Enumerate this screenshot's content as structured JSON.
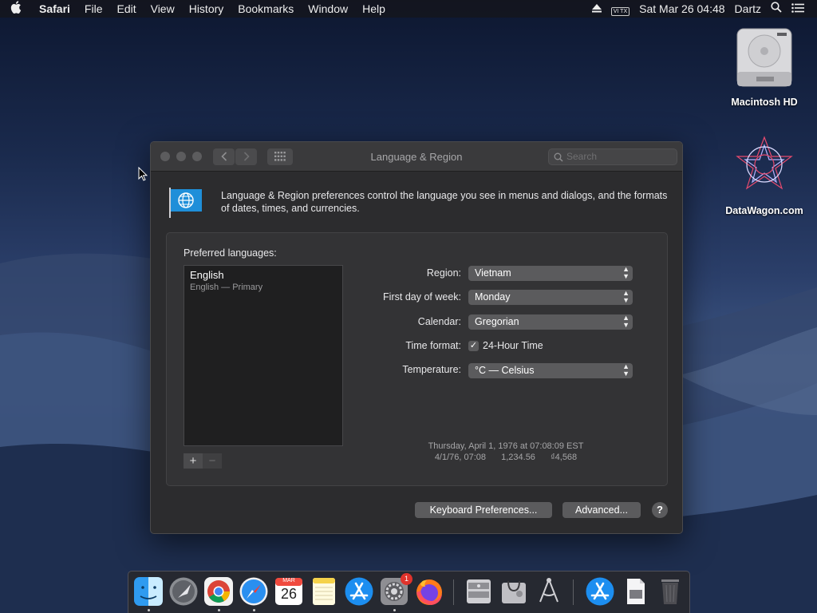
{
  "menubar": {
    "app": "Safari",
    "items": [
      "File",
      "Edit",
      "View",
      "History",
      "Bookmarks",
      "Window",
      "Help"
    ],
    "input_indicator": "VI TX",
    "datetime": "Sat Mar 26  04:48",
    "user": "Dartz"
  },
  "desktop": {
    "icons": [
      {
        "label": "Macintosh HD",
        "icon": "hard-drive-icon"
      },
      {
        "label": "DataWagon.com",
        "icon": "datawagon-icon"
      }
    ]
  },
  "window": {
    "title": "Language & Region",
    "search_placeholder": "Search",
    "description": "Language & Region preferences control the language you see in menus and dialogs, and the formats of dates, times, and currencies.",
    "preferred_languages_label": "Preferred languages:",
    "languages": [
      {
        "name": "English",
        "sub": "English — Primary"
      }
    ],
    "add_label": "+",
    "remove_label": "−",
    "settings": {
      "region_label": "Region:",
      "region_value": "Vietnam",
      "first_day_label": "First day of week:",
      "first_day_value": "Monday",
      "calendar_label": "Calendar:",
      "calendar_value": "Gregorian",
      "time_format_label": "Time format:",
      "time_format_value": "24-Hour Time",
      "time_format_checked": true,
      "temperature_label": "Temperature:",
      "temperature_value": "°C — Celsius"
    },
    "sample": {
      "line1": "Thursday, April 1, 1976 at 07:08:09 EST",
      "short_date": "4/1/76, 07:08",
      "number": "1,234.56",
      "currency": "₫4,568"
    },
    "keyboard_button": "Keyboard Preferences...",
    "advanced_button": "Advanced...",
    "help_label": "?"
  },
  "dock": {
    "calendar_month": "MAR",
    "calendar_day": "26",
    "prefs_badge": "1",
    "items": [
      "finder-icon",
      "launchpad-icon",
      "chrome-icon",
      "safari-icon",
      "calendar-icon",
      "notes-icon",
      "app-store-icon",
      "system-preferences-icon",
      "firefox-icon",
      "disk-utility-icon",
      "system-information-icon",
      "directory-utility-icon",
      "downloads-folder-icon",
      "documents-stack-icon",
      "trash-icon"
    ]
  },
  "colors": {
    "window_bg": "#2c2c2e",
    "popup_bg": "#5b5b5d",
    "flag_blue": "#1f8fd9"
  }
}
